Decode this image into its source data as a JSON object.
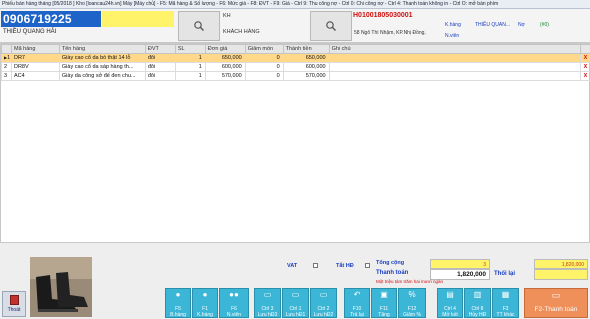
{
  "window": {
    "title": "Phiếu bán hàng tháng [05/2018 ]  Kho [loancau24h.vn]  Máy [Máy chủ] - F5: Mã hàng & Số lượng - F6: Mức giá - F8: ĐVT - F9: Giá - Ctrl 9: Thu công nợ - Ctrl 0: Chi công nợ - Ctrl 4: Thanh toán không in - Ctrl O: mở bán phím"
  },
  "customer": {
    "phone": "0906719225",
    "name": "THIỀU QUANG HẢI",
    "kh_label": "KH",
    "kh_value": "KHÁCH HÀNG",
    "address": "58 Ngô Thì Nhậm, KP.Nhị Đồng,",
    "invoice_no": "H01001805030001",
    "k_hang_label": "K.hàng",
    "k_hang_value": "THIỀU QUAN...",
    "no_label": "Nợ",
    "no_value": "(#0)",
    "n_vien_label": "N.viên"
  },
  "grid": {
    "headers": [
      "",
      "Mã hàng",
      "Tên hàng",
      "ĐVT",
      "SL",
      "Đơn giá",
      "Giảm món",
      "Thành tiền",
      "Ghi chú",
      ""
    ],
    "rows": [
      {
        "idx": "1",
        "code": "DR7",
        "name": "Giày cao cổ da bò thật 14 lỗ",
        "unit": "đôi",
        "qty": "1",
        "price": "650,000",
        "disc": "0",
        "total": "650,000",
        "note": "",
        "del": "X",
        "marker": "▶"
      },
      {
        "idx": "2",
        "code": "DR8V",
        "name": "Giày cao cổ da sáp hàng th...",
        "unit": "đôi",
        "qty": "1",
        "price": "600,000",
        "disc": "0",
        "total": "600,000",
        "note": "",
        "del": "X",
        "marker": ""
      },
      {
        "idx": "3",
        "code": "AC4",
        "name": "Giày da công sở đế đen chu...",
        "unit": "đôi",
        "qty": "1",
        "price": "570,000",
        "disc": "0",
        "total": "570,000",
        "note": "",
        "del": "X",
        "marker": ""
      }
    ]
  },
  "totals": {
    "vat_label": "VAT",
    "tat_hd_label": "Tắt HĐ",
    "tong_cong_label": "Tổng cộng",
    "tong_cong_value": "3",
    "right_value": "1,820,000",
    "thanh_toan_label": "Thanh toán",
    "thanh_toan_value": "1,820,000",
    "thoi_lai_label": "Thối lại",
    "in_words": "Một triệu tám trăm hai mươi ngàn"
  },
  "buttons": [
    {
      "key": "F5",
      "label": "B.hàng",
      "icon": "user-icon"
    },
    {
      "key": "F1",
      "label": "K.hàng",
      "icon": "user-icon"
    },
    {
      "key": "F6",
      "label": "N.viên",
      "icon": "users-icon"
    },
    {
      "key": "Ctrl 3",
      "label": "Lưu hĐ3",
      "icon": "doc-icon"
    },
    {
      "key": "Ctrl 1",
      "label": "Lưu hĐ1",
      "icon": "doc-icon"
    },
    {
      "key": "Ctrl 2",
      "label": "Lưu hĐ2",
      "icon": "doc-icon"
    },
    {
      "key": "F10",
      "label": "Trả lại",
      "icon": "return-icon"
    },
    {
      "key": "F11",
      "label": "Tặng",
      "icon": "gift-icon"
    },
    {
      "key": "F12",
      "label": "Giảm %",
      "icon": "percent-icon"
    },
    {
      "key": "Ctrl 4",
      "label": "Mở két",
      "icon": "cash-icon"
    },
    {
      "key": "Ctrl 8",
      "label": "Hủy HĐ",
      "icon": "trash-icon"
    },
    {
      "key": "F3",
      "label": "TT khác",
      "icon": "grid-icon"
    }
  ],
  "pay_button": {
    "label": "F2-Thanh toán",
    "icon": "money-icon"
  },
  "thoat": {
    "label": "Thoát"
  },
  "colors": {
    "accent_blue": "#1e63c8",
    "highlight_yellow": "#fff36a",
    "button_cyan": "#3bb6d6",
    "pay_orange": "#ef8f5a",
    "invoice_red": "#d01010"
  }
}
